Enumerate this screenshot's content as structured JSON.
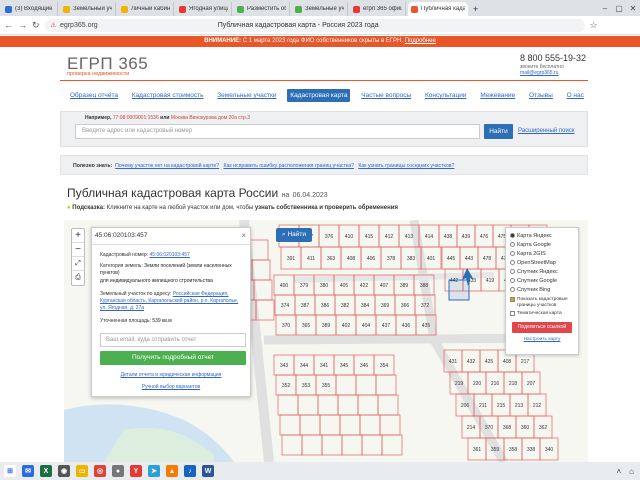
{
  "browser": {
    "tabs": [
      {
        "label": "(3) Входящие — Ру",
        "color": "#2d6cdf"
      },
      {
        "label": "Земельный участ",
        "color": "#f2b200"
      },
      {
        "label": "Личный кабинет",
        "color": "#f2b200"
      },
      {
        "label": "Ягодная улица —",
        "color": "#e53935"
      },
      {
        "label": "Разместить объяв",
        "color": "#4caf50"
      },
      {
        "label": "Земельные участ",
        "color": "#4caf50"
      },
      {
        "label": "егрп 365 официа",
        "color": "#e53935"
      },
      {
        "label": "Публичная кадас",
        "color": "#e8562a",
        "active": true
      }
    ],
    "url": "egrp365.org",
    "page_title": "Публичная кадастровая карта - Россия 2023 года"
  },
  "notice": {
    "bold": "ВНИМАНИЕ:",
    "text": " С 1 марта 2023 года ФИО собственников скрыты в ЕГРН. ",
    "link": "Подробнее"
  },
  "header": {
    "logo": "ЕГРП 365",
    "logo_sub": "проверка недвижимости",
    "phone": "8 800 555-19-32",
    "phone_sub": "звоните бесплатно",
    "email": "mail@egrp365.ru"
  },
  "nav": [
    {
      "label": "Образец отчёта"
    },
    {
      "label": "Кадастровая стоимость"
    },
    {
      "label": "Земельные участки"
    },
    {
      "label": "Кадастровая карта",
      "active": true
    },
    {
      "label": "Частые вопросы"
    },
    {
      "label": "Консультации"
    },
    {
      "label": "Межевание"
    },
    {
      "label": "Отзывы"
    },
    {
      "label": "О нас"
    }
  ],
  "search": {
    "example_label": "Например,",
    "example_num": "77:08:0009001:1536",
    "example_or": "или",
    "example_addr": "Москва Винокурова дом 20а стр.3",
    "placeholder": "Введите адрес или кадастровый номер",
    "button": "Найти",
    "advanced": "Расширенный поиск"
  },
  "useful": {
    "label": "Полезно знать:",
    "links": [
      "Почему участок нет на кадастровой карте?",
      "Как исправить ошибку расположения границ участка?",
      "Как узнать границы соседних участков?"
    ]
  },
  "page": {
    "title": "Публичная кадастровая карта России",
    "date_prefix": "на",
    "date": "06.04.2023",
    "tip_label": "Подсказка:",
    "tip_text": " Кликните на карте на любой участок или дом, чтобы ",
    "tip_bold": "узнать собственника и проверить обременения"
  },
  "map": {
    "find_button": "Найти",
    "zoom_in": "+",
    "zoom_out": "−",
    "parcels": [
      "373",
      "377",
      "376",
      "410",
      "415",
      "412",
      "413",
      "414",
      "391",
      "411",
      "363",
      "408",
      "406",
      "378",
      "383",
      "401",
      "400",
      "379",
      "380",
      "405",
      "422",
      "407",
      "389",
      "388",
      "374",
      "387",
      "386",
      "382",
      "384",
      "369",
      "366",
      "372",
      "370",
      "365",
      "389",
      "402",
      "404",
      "437",
      "436",
      "435",
      "438",
      "439",
      "476",
      "475",
      "440",
      "441",
      "445",
      "443",
      "478",
      "477",
      "479",
      "444",
      "442",
      "433",
      "419",
      "420",
      "423",
      "418",
      "431",
      "432",
      "425",
      "408",
      "217",
      "219",
      "220",
      "216",
      "218",
      "207",
      "206",
      "211",
      "215",
      "213",
      "212",
      "214",
      "370",
      "368",
      "360",
      "362",
      "361",
      "359",
      "358",
      "338",
      "340",
      "343",
      "344",
      "341",
      "345",
      "346",
      "354",
      "352",
      "353",
      "355"
    ]
  },
  "popup": {
    "cad_label": "45:06:020103:457",
    "cad_num_label": "Кадастровый номер:",
    "cad_num": "45:06:020103:457",
    "category_label": "Категория земель:",
    "category": "Земли поселений (земли населенных пунктов)",
    "usage": "для индивидуального жилищного строительства",
    "address_label": "Земельный участок по адресу:",
    "address": "Российская Федерация, Курганская область, Каргапольский район, р.п. Каргаполье, ул. Ягодная, д. 27а",
    "area_label": "Уточненная площадь:",
    "area": "539 кв.м",
    "email_placeholder": "Ваш email, куда отправить отчет",
    "report_button": "Получить подробный отчет",
    "details_link": "Детали отчета и юридическая информация",
    "manual_link": "Ручной выбор вариантов"
  },
  "layers": {
    "options": [
      {
        "label": "Карта Яндекс",
        "on": true
      },
      {
        "label": "Карта Google",
        "on": false
      },
      {
        "label": "Карта 2GIS",
        "on": false
      },
      {
        "label": "OpenStreetMap",
        "on": false
      },
      {
        "label": "Спутник Яндекс",
        "on": false
      },
      {
        "label": "Спутник Google",
        "on": false
      },
      {
        "label": "Спутник Bing",
        "on": false
      }
    ],
    "checks": [
      {
        "label": "Показать кадастровые границы участков",
        "on": true
      },
      {
        "label": "Тематическая карта",
        "on": false
      }
    ],
    "share": "Поделиться ссылкой",
    "configure": "Настроить карту"
  },
  "taskbar": {
    "icons": [
      {
        "name": "mail-app-icon",
        "color": "#2d6cdf",
        "glyph": "✉"
      },
      {
        "name": "excel-icon",
        "color": "#1d6f42",
        "glyph": "X"
      },
      {
        "name": "app-icon",
        "color": "#555",
        "glyph": "◉"
      },
      {
        "name": "folder-icon",
        "color": "#f2b200",
        "glyph": "▭"
      },
      {
        "name": "chrome-icon",
        "color": "#db4437",
        "glyph": "◎"
      },
      {
        "name": "app-circle-icon",
        "color": "#777",
        "glyph": "●"
      },
      {
        "name": "yandex-browser-icon",
        "color": "#e53935",
        "glyph": "Y"
      },
      {
        "name": "telegram-icon",
        "color": "#2aa1da",
        "glyph": "➤"
      },
      {
        "name": "app-orange-icon",
        "color": "#f57c00",
        "glyph": "▲"
      },
      {
        "name": "app-blue-icon",
        "color": "#1565c0",
        "glyph": "♪"
      },
      {
        "name": "word-icon",
        "color": "#2b579a",
        "glyph": "W"
      }
    ]
  }
}
